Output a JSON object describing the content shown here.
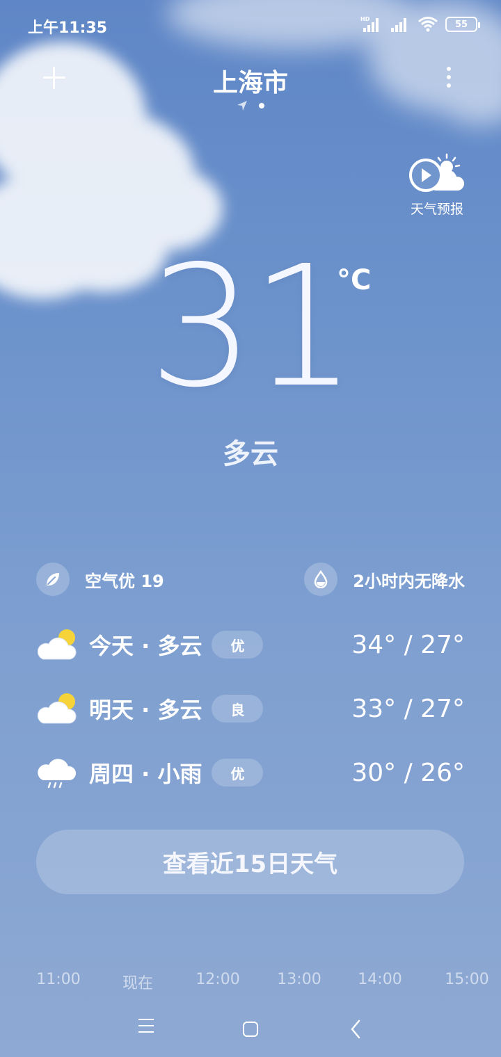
{
  "status_bar": {
    "time": "上午11:35",
    "battery": "55",
    "sim1_tag": "HD"
  },
  "header": {
    "city": "上海市",
    "page_count": 2
  },
  "video_forecast": {
    "label": "天气预报"
  },
  "current": {
    "temperature": "31",
    "unit": "°C",
    "condition": "多云"
  },
  "info": {
    "air_quality": "空气优 19",
    "precipitation": "2小时内无降水"
  },
  "days": [
    {
      "label": "今天 · 多云",
      "aqi": "优",
      "temps": "34° / 27°",
      "icon": "partly-cloudy-icon"
    },
    {
      "label": "明天 · 多云",
      "aqi": "良",
      "temps": "33° / 27°",
      "icon": "partly-cloudy-icon"
    },
    {
      "label": "周四 · 小雨",
      "aqi": "优",
      "temps": "30° / 26°",
      "icon": "light-rain-icon"
    }
  ],
  "forecast_button": "查看近15日天气",
  "hourly": {
    "labels": [
      "11:00",
      "现在",
      "12:00",
      "13:00",
      "14:00",
      "15:00"
    ]
  },
  "colors": {
    "sky_top": "#5f86c6",
    "sky_bottom": "#8ea9d3",
    "sun": "#f7d33a"
  }
}
